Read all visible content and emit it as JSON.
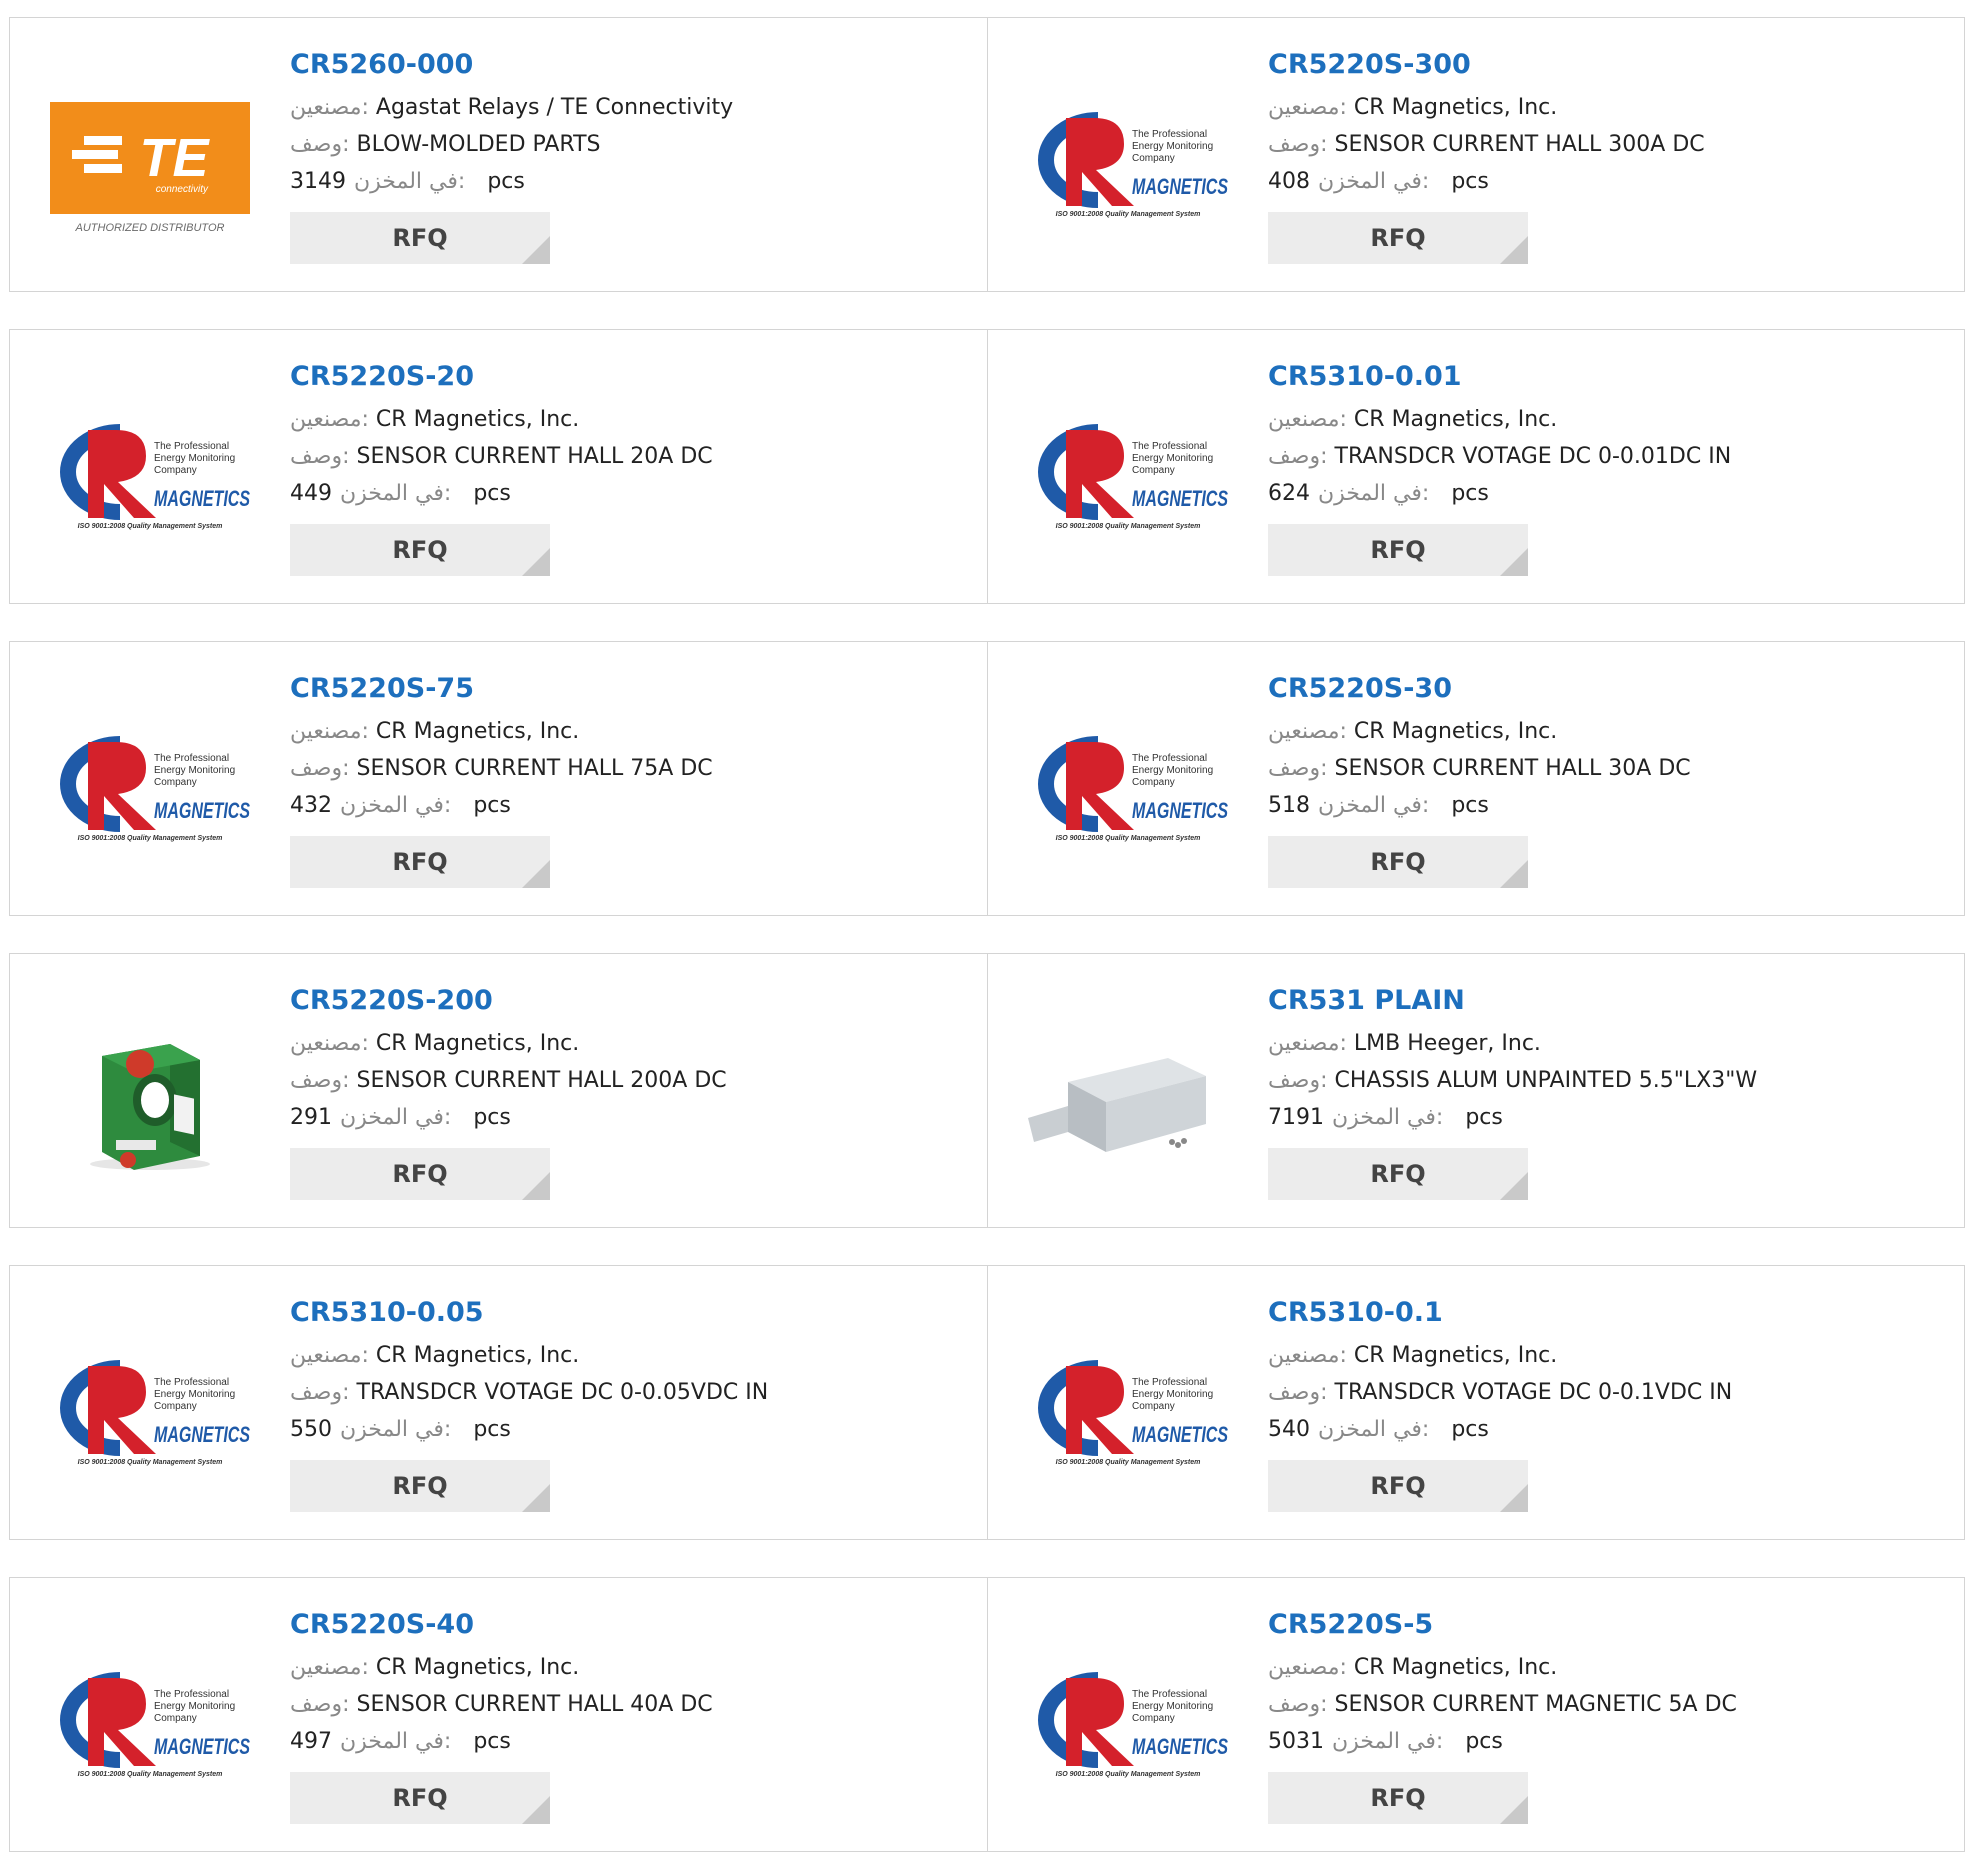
{
  "labels": {
    "manufacturer": "مصنعين:",
    "description": "وصف:",
    "in_stock": "في المخزن:",
    "unit": "pcs",
    "rfq": "RFQ"
  },
  "logos": {
    "te": {
      "brand": "TE",
      "sub": "connectivity",
      "tagline": "AUTHORIZED DISTRIBUTOR"
    },
    "cr": {
      "line1": "The Professional",
      "line2": "Energy Monitoring",
      "line3": "Company",
      "brand": "MAGNETICS",
      "footer": "ISO 9001:2008 Quality Management System"
    }
  },
  "colors": {
    "title": "#1d6fbd",
    "te_orange": "#f28d1a",
    "cr_red": "#d4212b",
    "cr_blue": "#1f5aa8",
    "button_bg": "#ececec",
    "border": "#d4d4d4"
  },
  "products": [
    {
      "part": "CR5260-000",
      "manufacturer": "Agastat Relays / TE Connectivity",
      "description": "BLOW-MOLDED PARTS",
      "stock": "3149",
      "image": "te-logo"
    },
    {
      "part": "CR5220S-300",
      "manufacturer": "CR Magnetics, Inc.",
      "description": "SENSOR CURRENT HALL 300A DC",
      "stock": "408",
      "image": "cr-magnetics-logo"
    },
    {
      "part": "CR5220S-20",
      "manufacturer": "CR Magnetics, Inc.",
      "description": "SENSOR CURRENT HALL 20A DC",
      "stock": "449",
      "image": "cr-magnetics-logo"
    },
    {
      "part": "CR5310-0.01",
      "manufacturer": "CR Magnetics, Inc.",
      "description": "TRANSDCR VOTAGE DC 0-0.01DC IN",
      "stock": "624",
      "image": "cr-magnetics-logo"
    },
    {
      "part": "CR5220S-75",
      "manufacturer": "CR Magnetics, Inc.",
      "description": "SENSOR CURRENT HALL 75A DC",
      "stock": "432",
      "image": "cr-magnetics-logo"
    },
    {
      "part": "CR5220S-30",
      "manufacturer": "CR Magnetics, Inc.",
      "description": "SENSOR CURRENT HALL 30A DC",
      "stock": "518",
      "image": "cr-magnetics-logo"
    },
    {
      "part": "CR5220S-200",
      "manufacturer": "CR Magnetics, Inc.",
      "description": "SENSOR CURRENT HALL 200A DC",
      "stock": "291",
      "image": "green-sensor-photo"
    },
    {
      "part": "CR531 PLAIN",
      "manufacturer": "LMB Heeger, Inc.",
      "description": "CHASSIS ALUM UNPAINTED 5.5\"LX3\"W",
      "stock": "7191",
      "image": "aluminum-chassis-photo"
    },
    {
      "part": "CR5310-0.05",
      "manufacturer": "CR Magnetics, Inc.",
      "description": "TRANSDCR VOTAGE DC 0-0.05VDC IN",
      "stock": "550",
      "image": "cr-magnetics-logo"
    },
    {
      "part": "CR5310-0.1",
      "manufacturer": "CR Magnetics, Inc.",
      "description": "TRANSDCR VOTAGE DC 0-0.1VDC IN",
      "stock": "540",
      "image": "cr-magnetics-logo"
    },
    {
      "part": "CR5220S-40",
      "manufacturer": "CR Magnetics, Inc.",
      "description": "SENSOR CURRENT HALL 40A DC",
      "stock": "497",
      "image": "cr-magnetics-logo"
    },
    {
      "part": "CR5220S-5",
      "manufacturer": "CR Magnetics, Inc.",
      "description": "SENSOR CURRENT MAGNETIC 5A DC",
      "stock": "5031",
      "image": "cr-magnetics-logo"
    }
  ]
}
